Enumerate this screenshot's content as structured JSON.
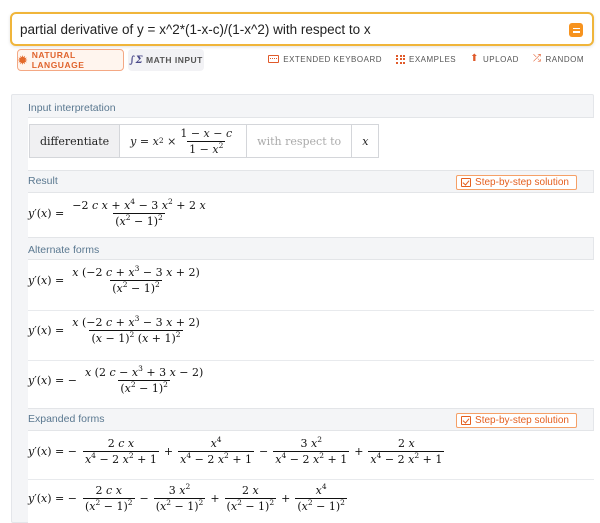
{
  "search": {
    "query": "partial derivative of y = x^2*(1-x-c)/(1-x^2) with respect to x"
  },
  "modes": {
    "natural_language": "NATURAL LANGUAGE",
    "math_input": "MATH INPUT"
  },
  "tools": {
    "extended_keyboard": "EXTENDED KEYBOARD",
    "examples": "EXAMPLES",
    "upload": "UPLOAD",
    "random": "RANDOM"
  },
  "pods": {
    "input_interpretation": {
      "title": "Input interpretation",
      "cells": [
        "differentiate",
        "y = x² × (1 − x − c)/(1 − x²)",
        "with respect to",
        "x"
      ]
    },
    "result": {
      "title": "Result",
      "button": "Step-by-step solution",
      "expression": "y′(x) = (−2 c x + x⁴ − 3 x² + 2 x)/(x² − 1)²"
    },
    "alternate_forms": {
      "title": "Alternate forms",
      "expressions": [
        "y′(x) = x (−2 c + x³ − 3 x + 2)/(x² − 1)²",
        "y′(x) = x (−2 c + x³ − 3 x + 2)/((x − 1)² (x + 1)²)",
        "y′(x) = −x (2 c − x³ + 3 x − 2)/(x² − 1)²"
      ]
    },
    "expanded_forms": {
      "title": "Expanded forms",
      "button": "Step-by-step solution",
      "expressions": [
        "y′(x) = −2 c x/(x⁴ − 2 x² + 1) + x⁴/(x⁴ − 2 x² + 1) − 3 x²/(x⁴ − 2 x² + 1) + 2 x/(x⁴ − 2 x² + 1)",
        "y′(x) = −2 c x/(x² − 1)² − 3 x²/(x² − 1)² + 2 x/(x² − 1)² + x⁴/(x² − 1)²"
      ]
    }
  },
  "colors": {
    "accent": "#f7931e",
    "search_border": "#f0b53a",
    "pod_title": "#5a7890",
    "step_button": "#e45f1f"
  }
}
